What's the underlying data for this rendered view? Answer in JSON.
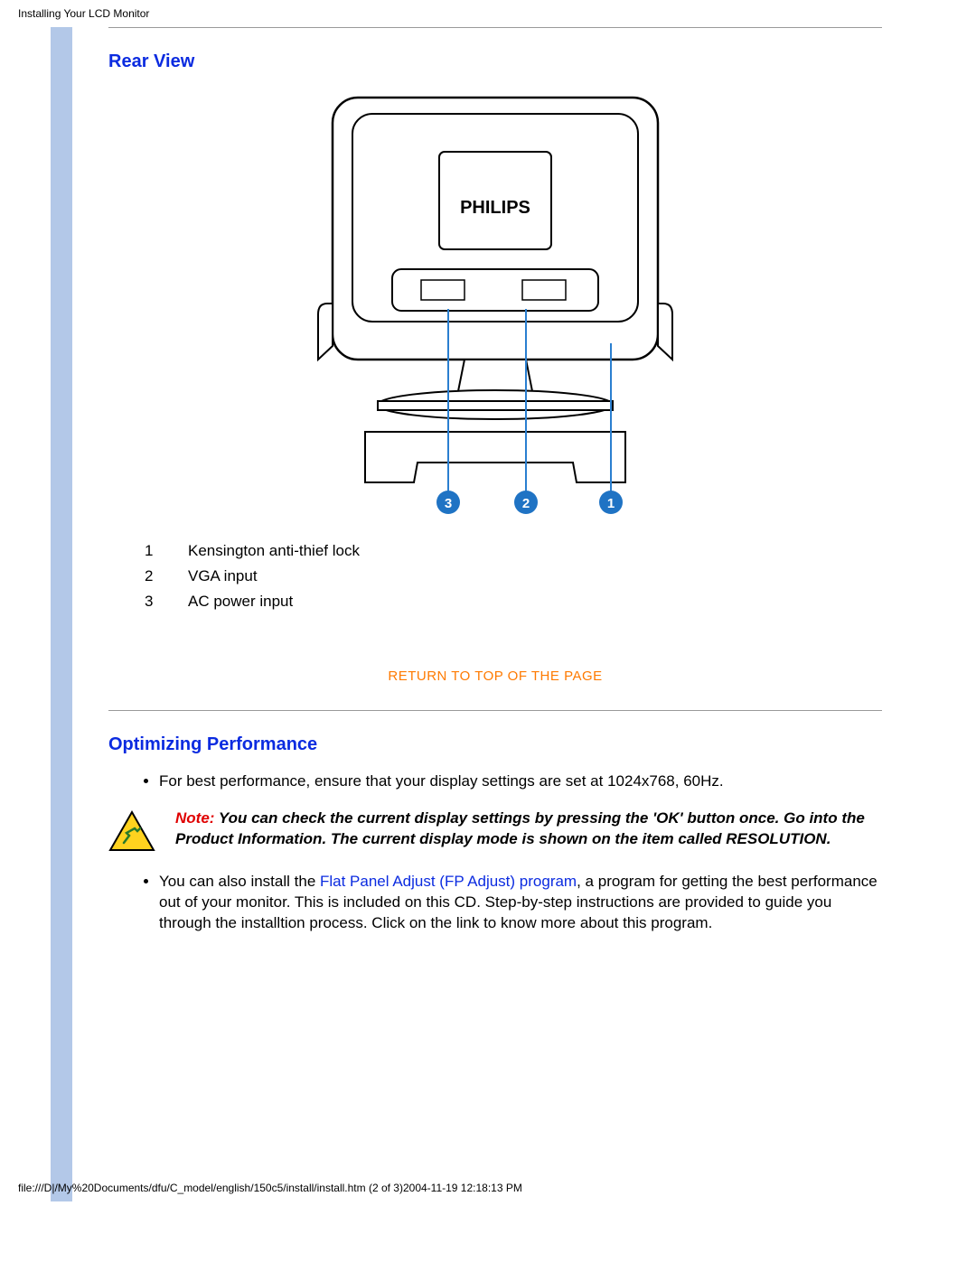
{
  "header": {
    "title": "Installing Your LCD Monitor"
  },
  "rear_view": {
    "heading": "Rear View",
    "brand": "PHILIPS",
    "callouts": {
      "c1": "1",
      "c2": "2",
      "c3": "3"
    },
    "legend": [
      {
        "num": "1",
        "label": "Kensington anti-thief lock"
      },
      {
        "num": "2",
        "label": "VGA input"
      },
      {
        "num": "3",
        "label": "AC power input"
      }
    ]
  },
  "return_link": "RETURN TO TOP OF THE PAGE",
  "optimizing": {
    "heading": "Optimizing Performance",
    "bullet1": "For best performance, ensure that your display settings are set at 1024x768, 60Hz.",
    "note_label": "Note:",
    "note_text": " You can check the current display settings by pressing the 'OK' button once. Go into the Product Information. The current display mode is shown on the item called RESOLUTION.",
    "bullet2_pre": "You can also install the ",
    "bullet2_link": "Flat Panel Adjust (FP Adjust) program",
    "bullet2_post": ", a program for getting the best performance out of your monitor. This is included on this CD. Step-by-step instructions are provided to guide you through the installtion process. Click on the link to know more about this program."
  },
  "footer": {
    "path": "file:///D|/My%20Documents/dfu/C_model/english/150c5/install/install.htm (2 of 3)2004-11-19 12:18:13 PM"
  }
}
